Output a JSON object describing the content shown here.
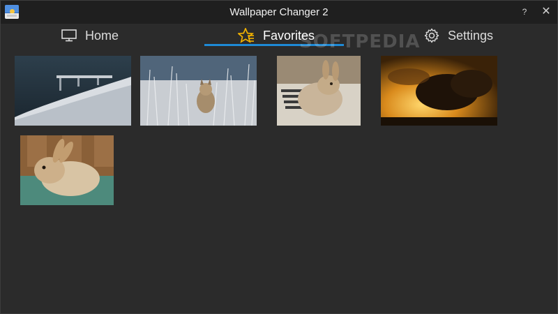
{
  "window": {
    "title": "Wallpaper Changer 2"
  },
  "titlebar": {
    "help_label": "?",
    "close_label": "✕"
  },
  "tabs": [
    {
      "label": "Home",
      "icon": "monitor-icon"
    },
    {
      "label": "Favorites",
      "icon": "star-list-icon",
      "active": true
    },
    {
      "label": "Settings",
      "icon": "gear-icon"
    }
  ],
  "watermark": "SOFTPEDIA",
  "favorites": [
    {
      "name": "snowy-pier"
    },
    {
      "name": "lynx-in-grass"
    },
    {
      "name": "rabbit-on-mat"
    },
    {
      "name": "sunset-clouds"
    },
    {
      "name": "rabbit-on-carpet"
    }
  ],
  "colors": {
    "accent": "#1e8ad6",
    "background": "#2b2b2b",
    "titlebar": "#1f1f1f",
    "star": "#f2b200"
  }
}
